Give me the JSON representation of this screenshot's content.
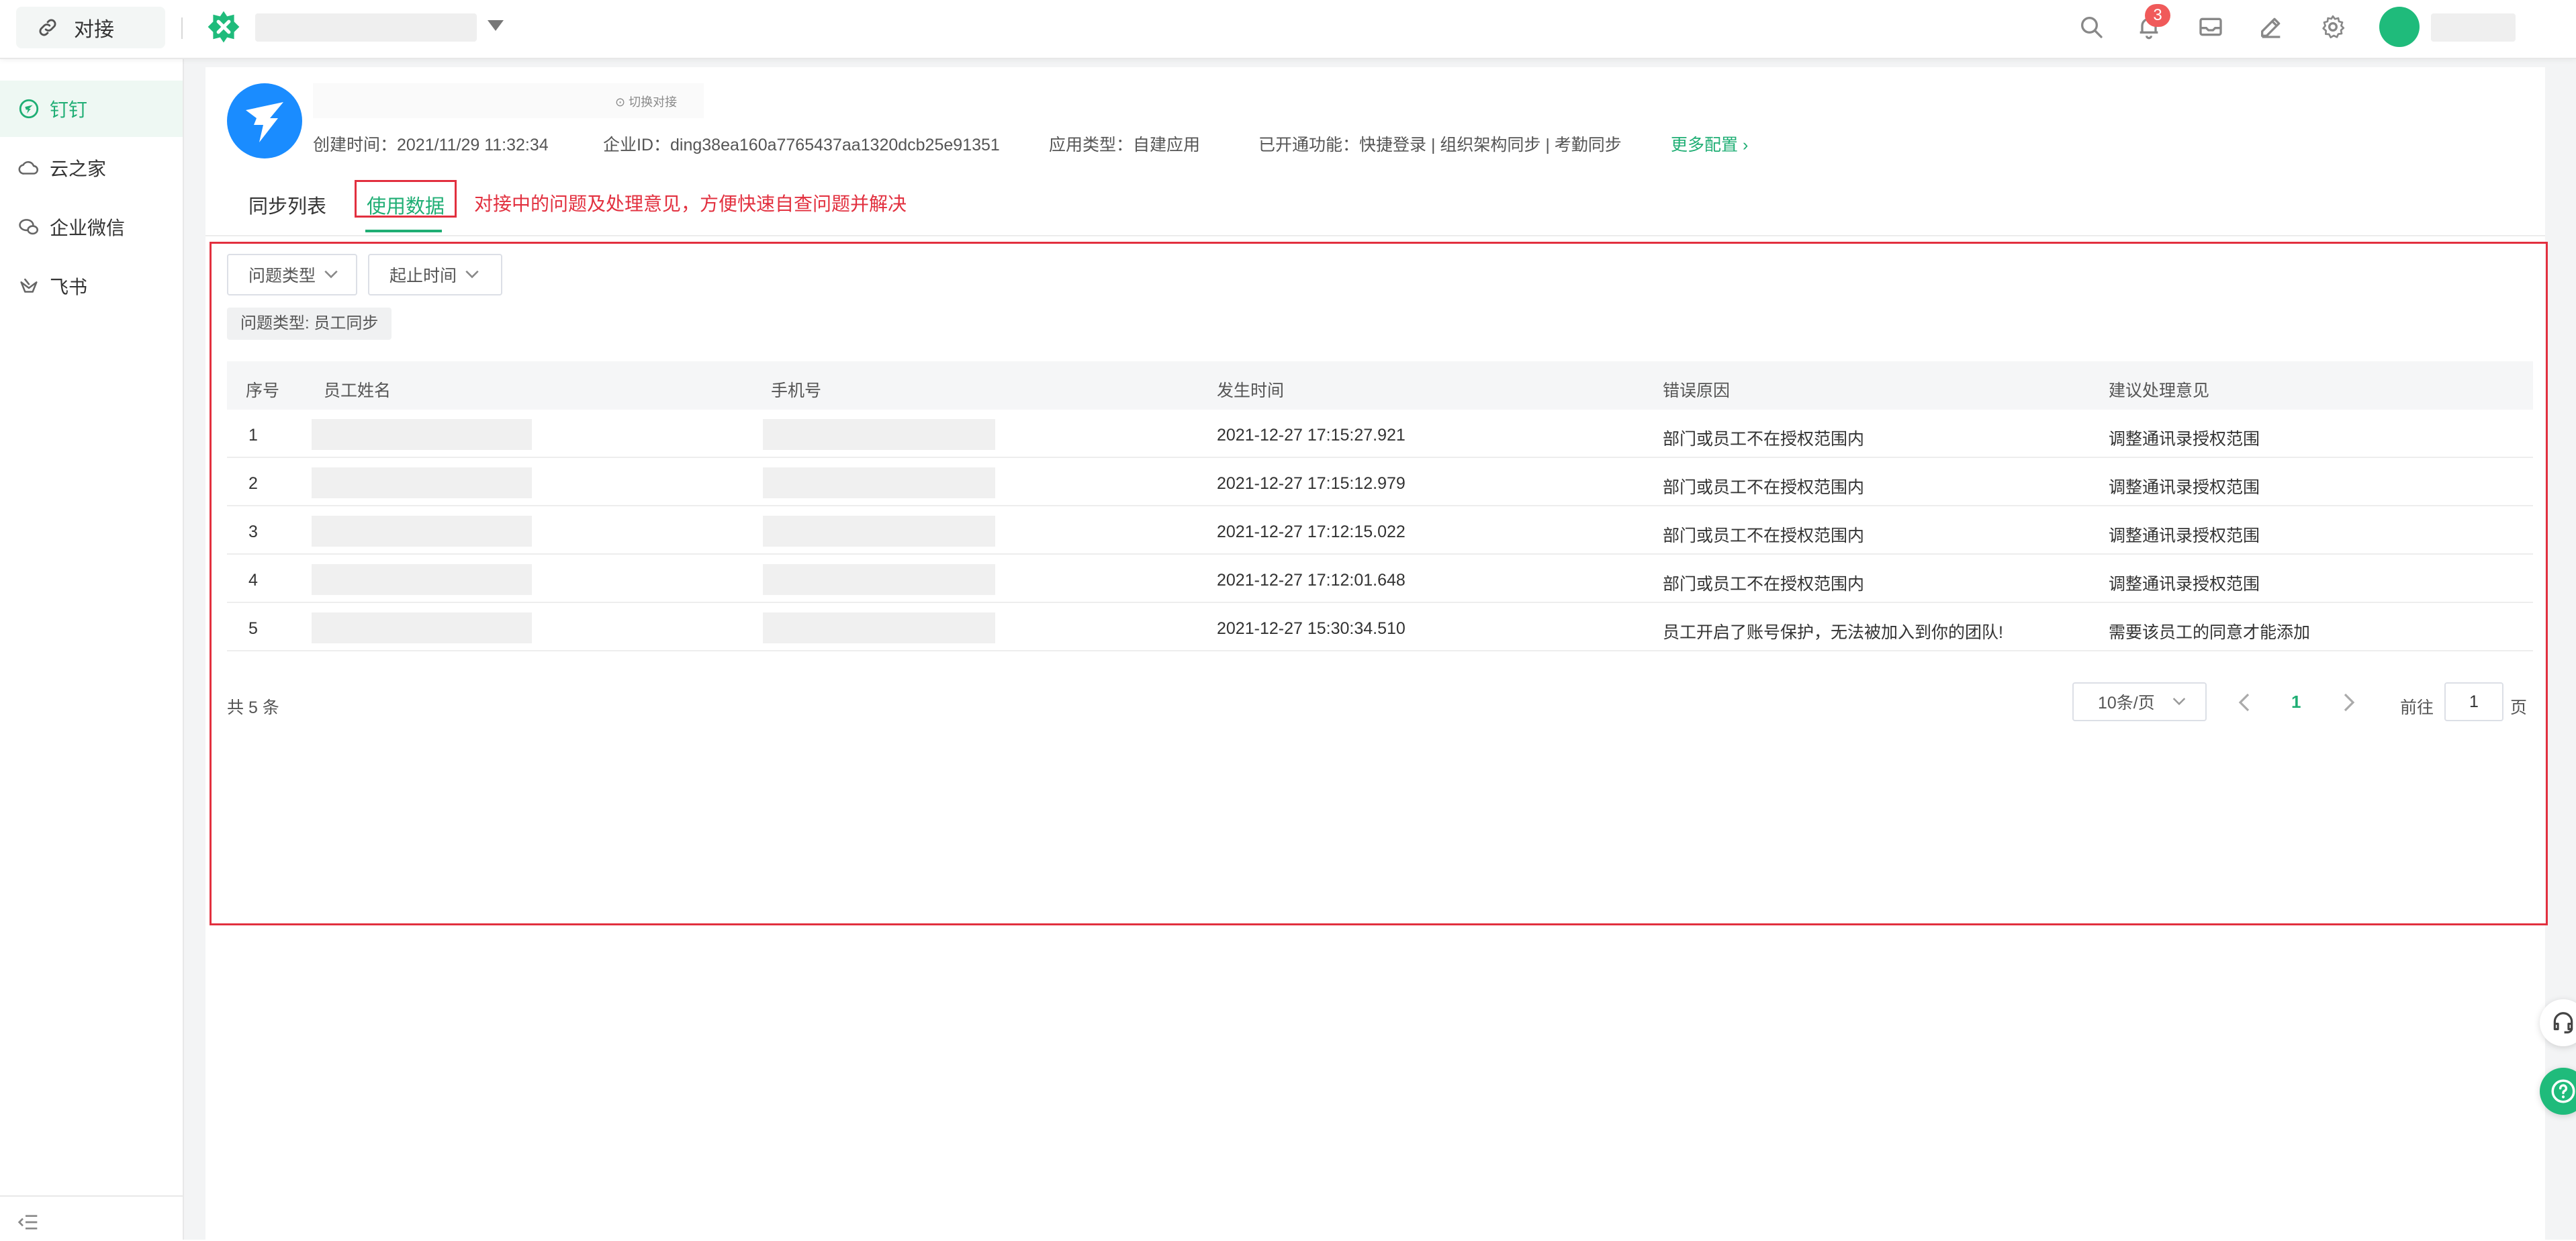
{
  "topbar": {
    "app_chip_label": "对接",
    "notification_count": "3"
  },
  "sidebar": {
    "items": [
      {
        "label": "钉钉",
        "icon": "dingtalk-icon"
      },
      {
        "label": "云之家",
        "icon": "cloud-icon"
      },
      {
        "label": "企业微信",
        "icon": "wecom-icon"
      },
      {
        "label": "飞书",
        "icon": "feishu-icon"
      }
    ]
  },
  "header": {
    "switch_label": "切换对接",
    "created": "创建时间：2021/11/29 11:32:34",
    "corp_id": "企业ID：ding38ea160a7765437aa1320dcb25e91351",
    "app_type": "应用类型：自建应用",
    "features": "已开通功能：快捷登录 | 组织架构同步 | 考勤同步",
    "more_config": "更多配置 ›"
  },
  "tabs": {
    "sync_list": "同步列表",
    "usage_data": "使用数据",
    "note": "对接中的问题及处理意见，方便快速自查问题并解决"
  },
  "filters": {
    "type_label": "问题类型",
    "time_label": "起止时间",
    "active_tag": "问题类型: 员工同步"
  },
  "table": {
    "headers": [
      "序号",
      "员工姓名",
      "手机号",
      "发生时间",
      "错误原因",
      "建议处理意见"
    ],
    "rows": [
      {
        "no": "1",
        "time": "2021-12-27 17:15:27.921",
        "reason": "部门或员工不在授权范围内",
        "advice": "调整通讯录授权范围"
      },
      {
        "no": "2",
        "time": "2021-12-27 17:15:12.979",
        "reason": "部门或员工不在授权范围内",
        "advice": "调整通讯录授权范围"
      },
      {
        "no": "3",
        "time": "2021-12-27 17:12:15.022",
        "reason": "部门或员工不在授权范围内",
        "advice": "调整通讯录授权范围"
      },
      {
        "no": "4",
        "time": "2021-12-27 17:12:01.648",
        "reason": "部门或员工不在授权范围内",
        "advice": "调整通讯录授权范围"
      },
      {
        "no": "5",
        "time": "2021-12-27 15:30:34.510",
        "reason": "员工开启了账号保护，无法被加入到你的团队!",
        "advice": "需要该员工的同意才能添加"
      }
    ]
  },
  "pagination": {
    "total": "共 5 条",
    "page_size": "10条/页",
    "current_page": "1",
    "goto_label": "前往",
    "goto_value": "1",
    "goto_suffix": "页"
  },
  "colors": {
    "accent": "#1fae74",
    "highlight": "#e2303f",
    "badge": "#f05a5a",
    "dingtalk_blue": "#1a8cff"
  }
}
